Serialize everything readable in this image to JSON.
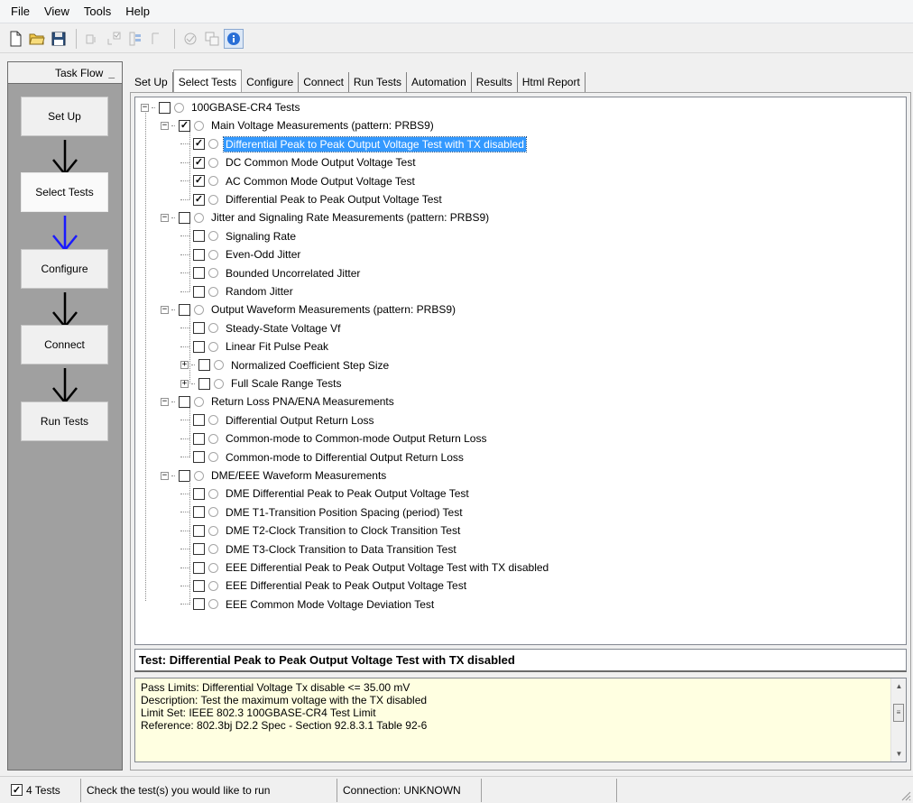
{
  "menu": [
    "File",
    "View",
    "Tools",
    "Help"
  ],
  "toolbar": {
    "icons": [
      "new-file-icon",
      "open-folder-icon",
      "save-icon",
      "undo-icon",
      "check-icon",
      "expand-icon",
      "collapse-icon",
      "layers-icon",
      "copy-icon",
      "info-icon"
    ]
  },
  "taskflow": {
    "title": "Task Flow",
    "minimize": "_",
    "steps": [
      "Set Up",
      "Select Tests",
      "Configure",
      "Connect",
      "Run Tests"
    ],
    "current_step": "Select Tests"
  },
  "tabs": [
    "Set Up",
    "Select Tests",
    "Configure",
    "Connect",
    "Run Tests",
    "Automation",
    "Results",
    "Html Report"
  ],
  "active_tab": "Select Tests",
  "tree": {
    "root": "100GBASE-CR4 Tests",
    "groups": [
      {
        "label": "Main Voltage Measurements (pattern: PRBS9)",
        "checked": true,
        "items": [
          {
            "label": "Differential Peak to Peak Output Voltage Test with TX disabled",
            "checked": true,
            "selected": true
          },
          {
            "label": "DC Common Mode Output Voltage Test",
            "checked": true
          },
          {
            "label": "AC Common Mode Output Voltage Test",
            "checked": true
          },
          {
            "label": "Differential Peak to Peak Output Voltage Test",
            "checked": true
          }
        ]
      },
      {
        "label": "Jitter and Signaling Rate Measurements (pattern: PRBS9)",
        "checked": false,
        "items": [
          {
            "label": "Signaling Rate",
            "checked": false
          },
          {
            "label": "Even-Odd Jitter",
            "checked": false
          },
          {
            "label": "Bounded Uncorrelated Jitter",
            "checked": false
          },
          {
            "label": "Random Jitter",
            "checked": false
          }
        ]
      },
      {
        "label": "Output Waveform Measurements (pattern: PRBS9)",
        "checked": false,
        "items": [
          {
            "label": "Steady-State Voltage Vf",
            "checked": false
          },
          {
            "label": "Linear Fit Pulse Peak",
            "checked": false
          },
          {
            "label": "Normalized Coefficient Step Size",
            "checked": false,
            "expandable": true
          },
          {
            "label": "Full Scale Range Tests",
            "checked": false,
            "expandable": true
          }
        ]
      },
      {
        "label": "Return Loss PNA/ENA Measurements",
        "checked": false,
        "items": [
          {
            "label": "Differential Output Return Loss",
            "checked": false
          },
          {
            "label": "Common-mode to Common-mode Output Return Loss",
            "checked": false
          },
          {
            "label": "Common-mode to Differential Output Return Loss",
            "checked": false
          }
        ]
      },
      {
        "label": "DME/EEE Waveform Measurements",
        "checked": false,
        "items": [
          {
            "label": "DME Differential Peak to Peak Output Voltage Test",
            "checked": false
          },
          {
            "label": "DME T1-Transition Position Spacing (period) Test",
            "checked": false
          },
          {
            "label": "DME T2-Clock Transition to Clock Transition Test",
            "checked": false
          },
          {
            "label": "DME T3-Clock Transition to Data Transition Test",
            "checked": false
          },
          {
            "label": "EEE Differential Peak to Peak Output Voltage Test with TX disabled",
            "checked": false
          },
          {
            "label": "EEE Differential Peak to Peak Output Voltage Test",
            "checked": false
          },
          {
            "label": "EEE Common Mode Voltage Deviation Test",
            "checked": false
          }
        ]
      }
    ]
  },
  "details": {
    "title": "Test: Differential Peak to Peak Output Voltage Test with TX disabled",
    "lines": [
      "Pass Limits: Differential Voltage Tx disable <= 35.00 mV",
      "Description: Test the maximum voltage with the TX disabled",
      "Limit Set: IEEE 802.3 100GBASE-CR4 Test Limit",
      "Reference: 802.3bj D2.2 Spec - Section 92.8.3.1 Table 92-6"
    ]
  },
  "status": {
    "tests_count": "4 Tests",
    "hint": "Check the test(s) you would like to run",
    "connection": "Connection: UNKNOWN"
  },
  "colors": {
    "selection": "#3399ff",
    "details_bg": "#ffffe1",
    "taskflow_bg": "#a0a0a0",
    "active_arrow": "#1a1aff"
  }
}
